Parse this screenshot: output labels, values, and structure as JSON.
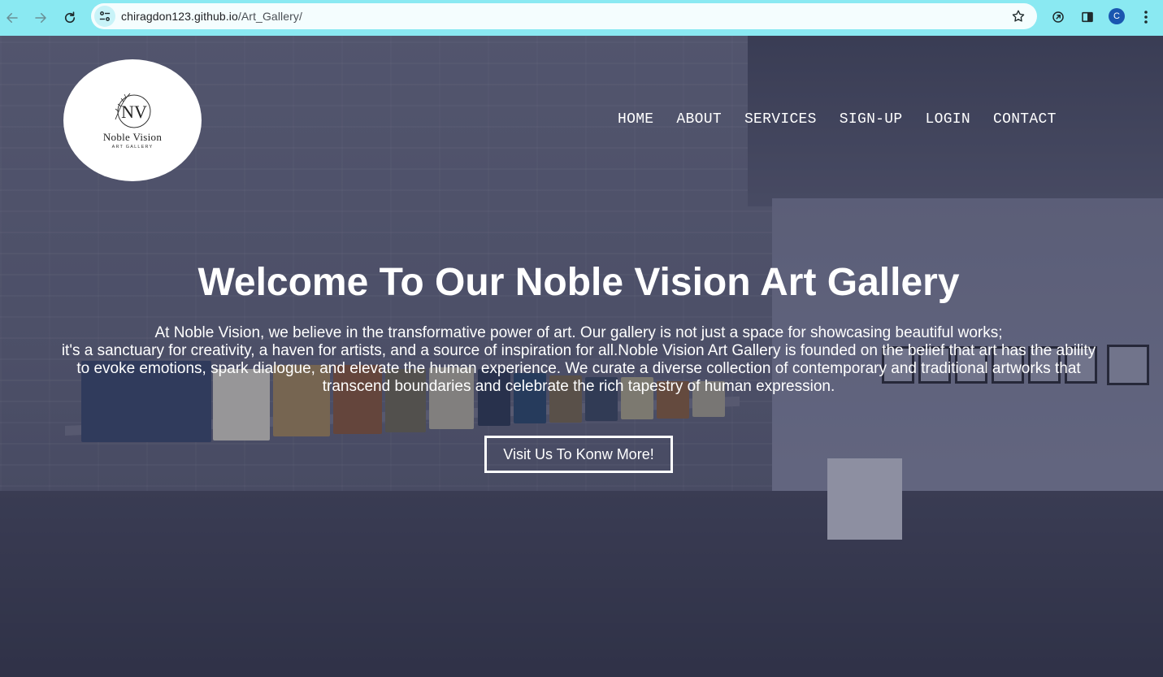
{
  "browser": {
    "url_host": "chiragdon123.github.io",
    "url_path": "/Art_Gallery/",
    "profile_initial": "C"
  },
  "logo": {
    "monogram": "NV",
    "name": "Noble Vision",
    "subtitle": "ART GALLERY"
  },
  "nav": {
    "items": [
      "HOME",
      "ABOUT",
      "SERVICES",
      "SIGN-UP",
      "LOGIN",
      "CONTACT"
    ]
  },
  "hero": {
    "title": "Welcome To Our Noble Vision Art Gallery",
    "intro_line1": "At Noble Vision, we believe in the transformative power of art. Our gallery is not just a space for showcasing beautiful works;",
    "intro_line2": "it's a sanctuary for creativity, a haven for artists, and a source of inspiration for all.Noble Vision Art Gallery is founded on the belief that art has the ability to evoke emotions, spark dialogue, and elevate the human experience. We curate a diverse collection of contemporary and traditional artworks that transcend boundaries and celebrate the rich tapestry of human expression.",
    "cta_label": "Visit Us To Konw More!"
  },
  "colors": {
    "chrome_bg": "#8ae9f2",
    "text_white": "#ffffff"
  }
}
